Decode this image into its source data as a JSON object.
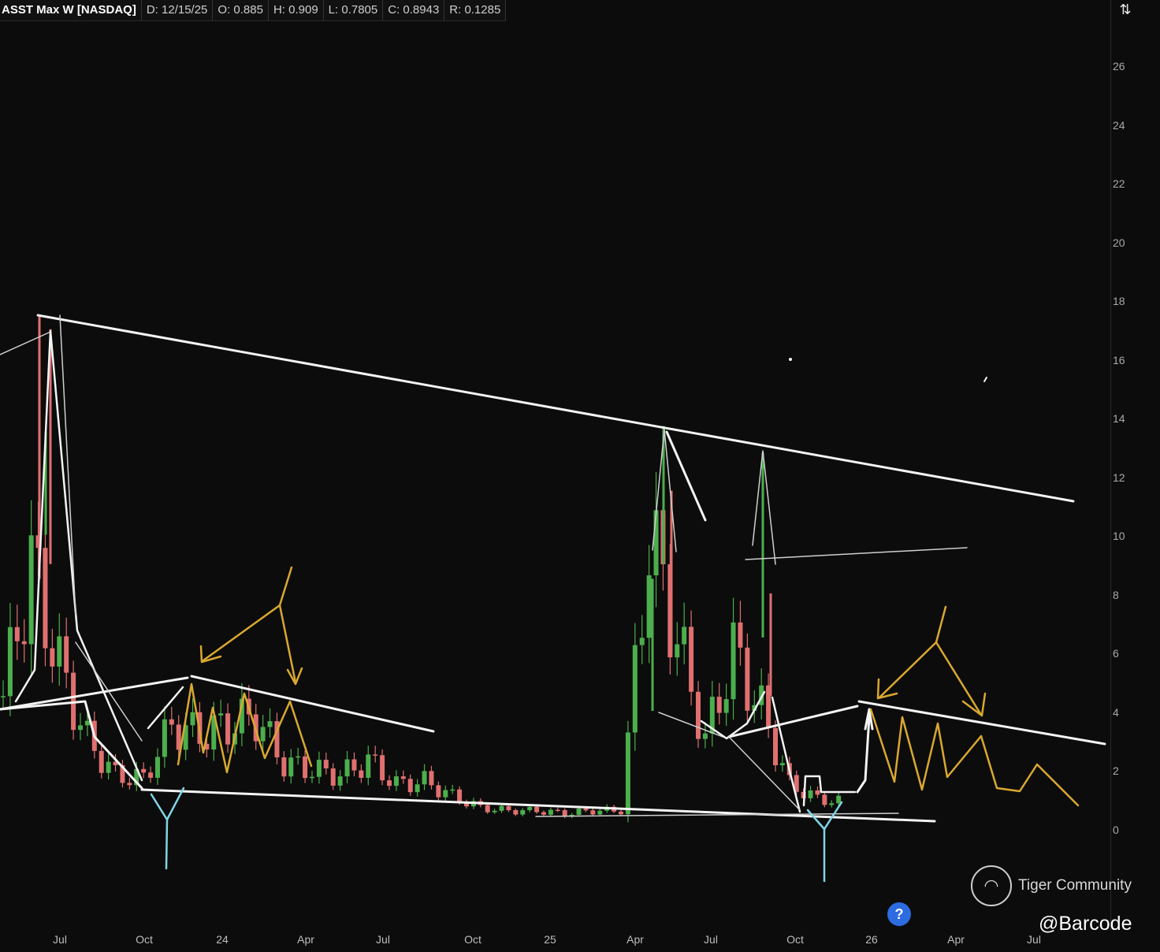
{
  "header": {
    "title": "ASST Max W [NASDAQ]",
    "date": "D: 12/15/25",
    "open": "O: 0.885",
    "high": "H: 0.909",
    "low": "L: 0.7805",
    "close": "C: 0.8943",
    "range": "R: 0.1285"
  },
  "y_axis": {
    "labels": [
      "26",
      "24",
      "22",
      "20",
      "18",
      "16",
      "14",
      "12",
      "10",
      "8",
      "6",
      "4",
      "2",
      "0"
    ]
  },
  "x_axis": {
    "labels": [
      "Jul",
      "Oct",
      "24",
      "Apr",
      "Jul",
      "Oct",
      "25",
      "Apr",
      "Jul",
      "Oct",
      "26",
      "Apr",
      "Jul"
    ]
  },
  "watermark": {
    "text": "Tiger Community"
  },
  "handle": "@Barcode",
  "help_label": "?",
  "colors": {
    "up": "#4cae4c",
    "down": "#e07070",
    "drawing": "#f4f4f4",
    "annotation": "#d9a830",
    "marker": "#7fd6e6",
    "background": "#0c0c0c"
  },
  "chart_data": {
    "type": "candlestick",
    "ticker": "ASST",
    "exchange": "NASDAQ",
    "interval": "W",
    "ylim": [
      0,
      26
    ],
    "x": [
      "2023-06",
      "2023-07",
      "2023-08",
      "2023-09",
      "2023-10",
      "2023-11",
      "2023-12",
      "2024-01",
      "2024-02",
      "2024-03",
      "2024-04",
      "2024-05",
      "2024-06",
      "2024-07",
      "2024-08",
      "2024-09",
      "2024-10",
      "2024-11",
      "2024-12",
      "2025-01",
      "2025-02",
      "2025-03",
      "2025-04",
      "2025-05",
      "2025-06",
      "2025-07",
      "2025-08",
      "2025-09",
      "2025-10",
      "2025-11",
      "2025-12"
    ],
    "close": [
      4.5,
      9.0,
      5.5,
      3.0,
      1.8,
      1.7,
      3.5,
      3.2,
      3.5,
      3.8,
      2.2,
      2.0,
      1.8,
      2.3,
      1.5,
      1.6,
      1.1,
      0.7,
      0.6,
      0.6,
      0.5,
      0.6,
      0.6,
      10.0,
      6.5,
      3.0,
      6.0,
      4.0,
      1.5,
      1.0,
      0.89
    ],
    "last_bar": {
      "open": 0.885,
      "high": 0.909,
      "low": 0.7805,
      "close": 0.8943
    }
  }
}
